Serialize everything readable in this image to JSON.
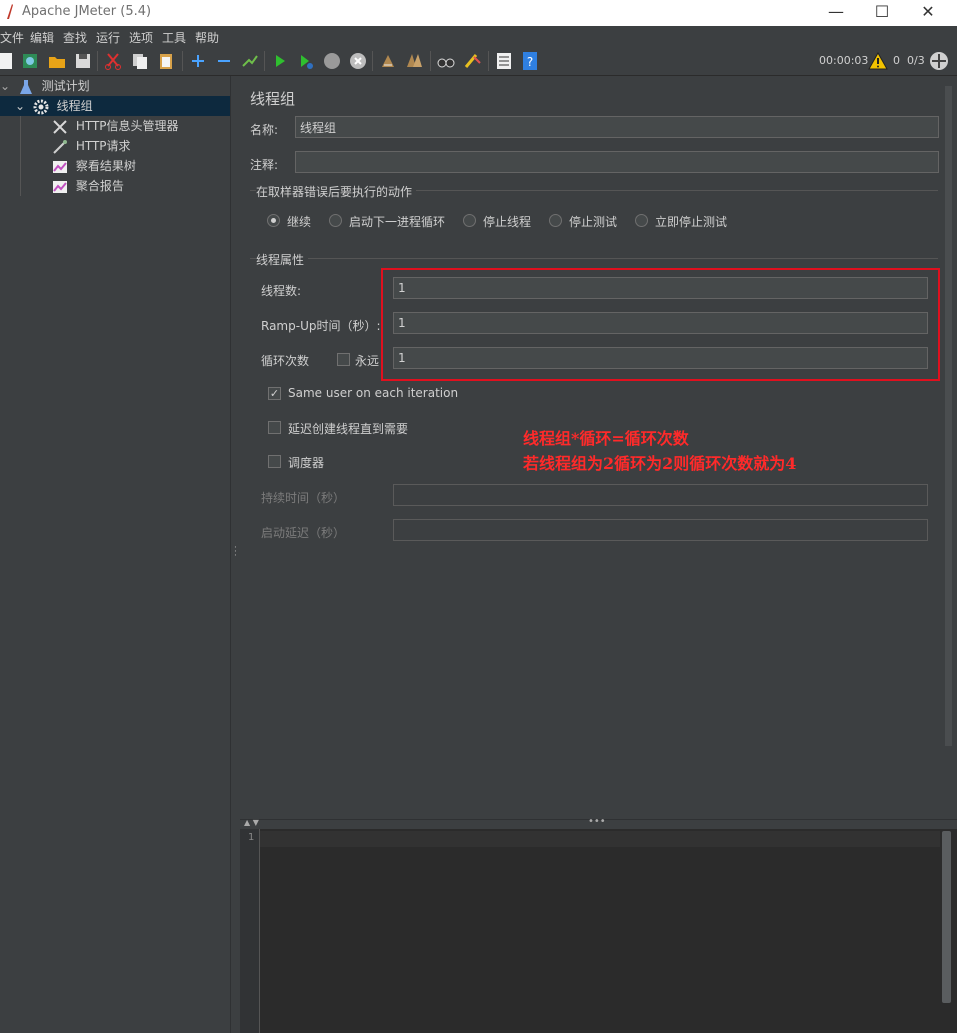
{
  "window": {
    "title": "Apache JMeter (5.4)",
    "minimize": "—",
    "maximize": "☐",
    "close": "✕"
  },
  "menu": [
    "文件",
    "编辑",
    "查找",
    "运行",
    "选项",
    "工具",
    "帮助"
  ],
  "toolbar": {
    "elapsed": "00:00:03",
    "warnings": "0",
    "threads": "0/3"
  },
  "tree": {
    "items": [
      {
        "label": "测试计划",
        "icon": "flask-icon"
      },
      {
        "label": "线程组",
        "icon": "gear-icon"
      },
      {
        "label": "HTTP信息头管理器",
        "icon": "tools-icon"
      },
      {
        "label": "HTTP请求",
        "icon": "pipette-icon"
      },
      {
        "label": "察看结果树",
        "icon": "graph-icon"
      },
      {
        "label": "聚合报告",
        "icon": "graph-icon"
      }
    ]
  },
  "panel": {
    "title": "线程组",
    "name_label": "名称:",
    "name_value": "线程组",
    "comment_label": "注释:",
    "comment_value": "",
    "error_group_title": "在取样器错误后要执行的动作",
    "error_actions": [
      "继续",
      "启动下一进程循环",
      "停止线程",
      "停止测试",
      "立即停止测试"
    ],
    "thread_props_title": "线程属性",
    "threads_label": "线程数:",
    "threads_value": "1",
    "rampup_label": "Ramp-Up时间（秒）:",
    "rampup_value": "1",
    "loop_label": "循环次数",
    "forever_label": "永远",
    "loop_value": "1",
    "same_user_label": "Same user on each iteration",
    "delay_label": "延迟创建线程直到需要",
    "scheduler_label": "调度器",
    "duration_label": "持续时间（秒）",
    "startup_delay_label": "启动延迟（秒）"
  },
  "annotation": {
    "line1": "线程组*循环=循环次数",
    "line2": "若线程组为2循环为2则循环次数就为4"
  },
  "log": {
    "line_number": "1"
  },
  "colors": {
    "background": "#3c3f41",
    "selection": "#0d293e",
    "annotation_red": "#e0101e"
  }
}
